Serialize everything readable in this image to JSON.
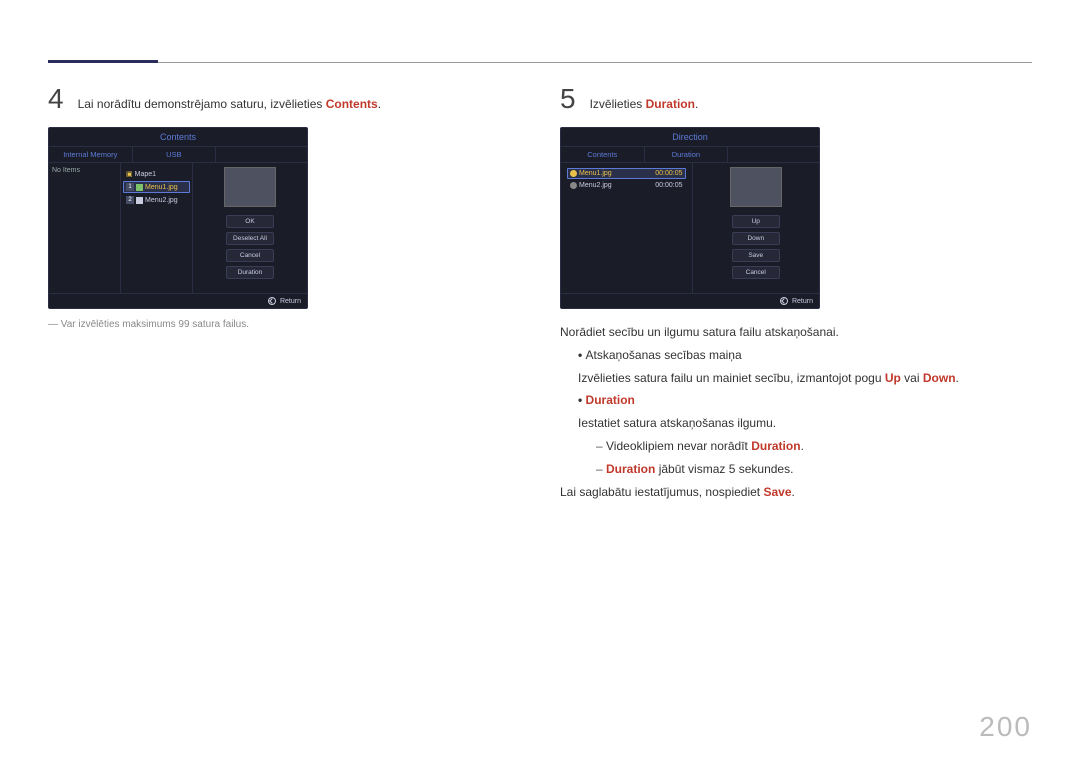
{
  "step4": {
    "num": "4",
    "text_pre": "Lai norādītu demonstrējamo saturu, izvēlieties ",
    "text_accent": "Contents",
    "text_post": ".",
    "footnote": "Var izvēlēties maksimums 99 satura failus.",
    "screen": {
      "title": "Contents",
      "col1": "Internal Memory",
      "col2": "USB",
      "no_items": "No Items",
      "folder": "Mape1",
      "file1": "Menu1.jpg",
      "file2": "Menu2.jpg",
      "btn_ok": "OK",
      "btn_deselect": "Deselect All",
      "btn_cancel": "Cancel",
      "btn_duration": "Duration",
      "return": "Return"
    }
  },
  "step5": {
    "num": "5",
    "text_pre": "Izvēlieties ",
    "text_accent": "Duration",
    "text_post": ".",
    "screen": {
      "title": "Direction",
      "col1": "Contents",
      "col2": "Duration",
      "file1": "Menu1.jpg",
      "dur1": "00:00:05",
      "file2": "Menu2.jpg",
      "dur2": "00:00:05",
      "btn_up": "Up",
      "btn_down": "Down",
      "btn_save": "Save",
      "btn_cancel": "Cancel",
      "return": "Return"
    },
    "prose": {
      "l1": "Norādiet secību un ilgumu satura failu atskaņošanai.",
      "l2": "Atskaņošanas secības maiņa",
      "l3_pre": "Izvēlieties satura failu un mainiet secību, izmantojot pogu ",
      "l3_up": "Up",
      "l3_mid": " vai ",
      "l3_down": "Down",
      "l3_post": ".",
      "l4": "Duration",
      "l5": "Iestatiet satura atskaņošanas ilgumu.",
      "l6_pre": "Videoklipiem nevar norādīt ",
      "l6_acc": "Duration",
      "l6_post": ".",
      "l7_acc": "Duration",
      "l7_post": " jābūt vismaz 5 sekundes.",
      "l8_pre": "Lai saglabātu iestatījumus, nospiediet ",
      "l8_acc": "Save",
      "l8_post": "."
    }
  },
  "page_number": "200"
}
